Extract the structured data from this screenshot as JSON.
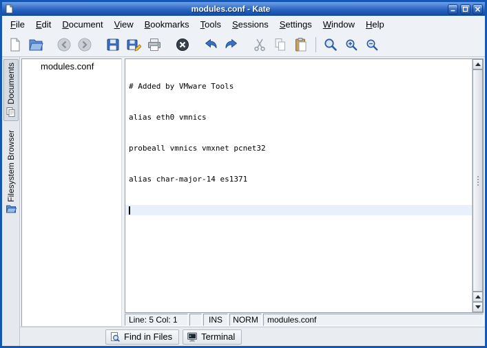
{
  "window": {
    "title": "modules.conf - Kate"
  },
  "colors": {
    "frame": "#1456b4",
    "titlebar_top": "#6ea0e6",
    "titlebar_bottom": "#0d4aa6",
    "chrome_bg": "#eef1f5",
    "current_line_highlight": "#e8f0fb",
    "editor_bg": "#ffffff"
  },
  "menubar": {
    "items": [
      {
        "label": "File"
      },
      {
        "label": "Edit"
      },
      {
        "label": "Document"
      },
      {
        "label": "View"
      },
      {
        "label": "Bookmarks"
      },
      {
        "label": "Tools"
      },
      {
        "label": "Sessions"
      },
      {
        "label": "Settings"
      },
      {
        "label": "Window"
      },
      {
        "label": "Help"
      }
    ]
  },
  "toolbar": {
    "buttons": [
      {
        "name": "new-document",
        "icon": "new-document-icon",
        "disabled": false
      },
      {
        "name": "open",
        "icon": "open-folder-icon",
        "disabled": false
      },
      {
        "name": "back",
        "icon": "back-arrow-icon",
        "disabled": true
      },
      {
        "name": "forward",
        "icon": "forward-arrow-icon",
        "disabled": true
      },
      {
        "name": "save",
        "icon": "save-floppy-icon",
        "disabled": false
      },
      {
        "name": "save-as",
        "icon": "save-as-floppy-pencil-icon",
        "disabled": false
      },
      {
        "name": "print",
        "icon": "printer-icon",
        "disabled": false
      },
      {
        "name": "close-document",
        "icon": "close-circle-icon",
        "disabled": false
      },
      {
        "name": "undo",
        "icon": "undo-arrow-icon",
        "disabled": false
      },
      {
        "name": "redo",
        "icon": "redo-arrow-icon",
        "disabled": false
      },
      {
        "name": "cut",
        "icon": "scissors-icon",
        "disabled": true
      },
      {
        "name": "copy",
        "icon": "copy-pages-icon",
        "disabled": true
      },
      {
        "name": "paste",
        "icon": "clipboard-icon",
        "disabled": false
      },
      {
        "name": "find",
        "icon": "magnifier-icon",
        "disabled": false
      },
      {
        "name": "zoom-in",
        "icon": "magnifier-plus-icon",
        "disabled": false
      },
      {
        "name": "zoom-out",
        "icon": "magnifier-minus-icon",
        "disabled": false
      }
    ]
  },
  "sidebar": {
    "tabs": [
      {
        "label": "Documents",
        "active": true
      },
      {
        "label": "Filesystem Browser",
        "active": false
      }
    ]
  },
  "document_list": {
    "items": [
      {
        "label": "modules.conf"
      }
    ]
  },
  "editor": {
    "lines": [
      "# Added by VMware Tools",
      "alias eth0 vmnics",
      "probeall vmnics vmxnet pcnet32",
      "alias char-major-14 es1371",
      ""
    ],
    "cursor": {
      "line": 5,
      "col": 1
    }
  },
  "statusbar": {
    "line_col": "Line: 5 Col: 1",
    "insert_mode": "INS",
    "selection_mode": "NORM",
    "filename": "modules.conf"
  },
  "bottom_tabs": [
    {
      "label": "Find in Files"
    },
    {
      "label": "Terminal"
    }
  ]
}
